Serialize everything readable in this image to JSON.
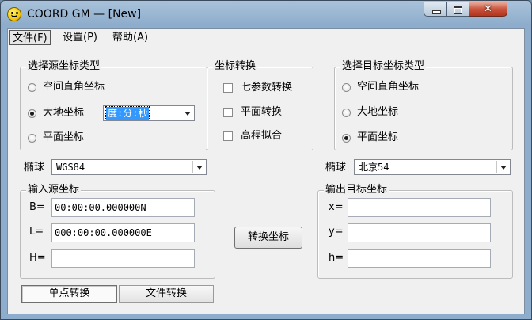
{
  "window": {
    "title": "COORD GM — [New]"
  },
  "menu": {
    "file": "文件(F)",
    "settings": "设置(P)",
    "help": "帮助(A)"
  },
  "source_type": {
    "legend": "选择源坐标类型",
    "options": [
      "空间直角坐标",
      "大地坐标",
      "平面坐标"
    ],
    "selected": "大地坐标",
    "format_value": "度:分:秒"
  },
  "transform": {
    "legend": "坐标转换",
    "options": [
      "七参数转换",
      "平面转换",
      "高程拟合"
    ]
  },
  "target_type": {
    "legend": "选择目标坐标类型",
    "options": [
      "空间直角坐标",
      "大地坐标",
      "平面坐标"
    ],
    "selected": "平面坐标"
  },
  "source_ellipsoid": {
    "label": "椭球",
    "value": "WGS84"
  },
  "target_ellipsoid": {
    "label": "椭球",
    "value": "北京54"
  },
  "input": {
    "legend": "输入源坐标",
    "b_label": "B=",
    "b_value": "00:00:00.000000N",
    "l_label": "L=",
    "l_value": "000:00:00.000000E",
    "h_label": "H=",
    "h_value": ""
  },
  "convert_button": "转换坐标",
  "output": {
    "legend": "输出目标坐标",
    "x_label": "x=",
    "x_value": "",
    "y_label": "y=",
    "y_value": "",
    "h_label": "h=",
    "h_value": ""
  },
  "mode_tabs": [
    "单点转换",
    "文件转换"
  ]
}
